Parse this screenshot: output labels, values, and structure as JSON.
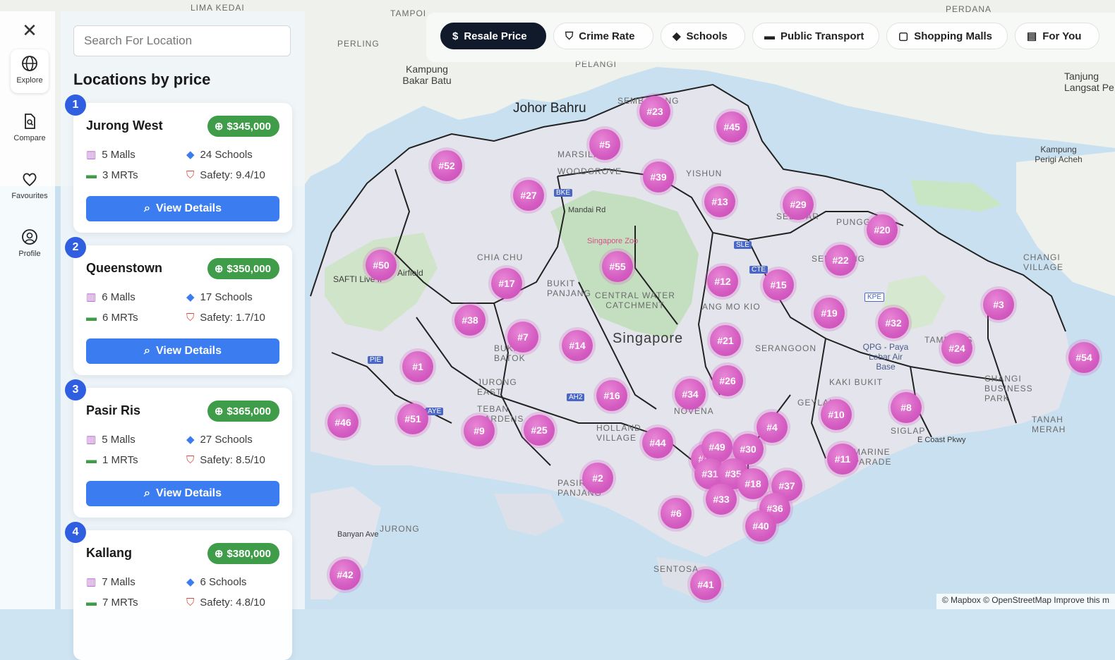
{
  "map": {
    "labels": [
      "LIMA KEDAI",
      "TAMPOI",
      "PERDANA",
      "PERLING",
      "PELANGI",
      "Kampung Bakar Batu",
      "Johor Bahru",
      "Tanjung Langsat Pe",
      "Kampung Perigi Acheh",
      "Singapore Zoo",
      "SAFTI Live IF",
      "Airfield",
      "CENTRAL WATER CATCHMENT",
      "Singapore",
      "CHIA CHU",
      "BUKIT PANJANG",
      "BUKIT BATOK",
      "JURONG EAST",
      "TEBAN GARDENS",
      "HOLLAND VILLAGE",
      "PASIR PANJANG",
      "JURONG",
      "SENTOSA",
      "NOVENA",
      "ANG MO KIO",
      "SERANGOON",
      "QPG - Paya Lebar Air Base",
      "TAMPINES",
      "CHANGI VILLAGE",
      "CHANGI BUSINESS PARK",
      "TANAH MERAH",
      "SIGLAP",
      "MARINE PARADE",
      "KAKI BUKIT",
      "GEYLANG",
      "WOODGROVE",
      "MARSILING",
      "YISHUN",
      "SELETAR",
      "PUNGGOL",
      "SENGKANG",
      "SEMBAWANG",
      "Mandai Rd",
      "E Coast Pkwy",
      "Banyan Ave",
      "AYE",
      "PIE",
      "KPE",
      "CTE",
      "SLE",
      "BKE",
      "AH2"
    ],
    "markers": [
      "#23",
      "#45",
      "#5",
      "#52",
      "#39",
      "#27",
      "#13",
      "#29",
      "#20",
      "#50",
      "#55",
      "#22",
      "#17",
      "#12",
      "#15",
      "#3",
      "#19",
      "#38",
      "#7",
      "#14",
      "#32",
      "#21",
      "#24",
      "#54",
      "#1",
      "#16",
      "#34",
      "#26",
      "#46",
      "#51",
      "#9",
      "#25",
      "#10",
      "#8",
      "#4",
      "#44",
      "#49",
      "#30",
      "#11",
      "#2",
      "#35",
      "#18",
      "#37",
      "#33",
      "#36",
      "#6",
      "#40",
      "#42",
      "#41",
      "#43",
      "#31"
    ],
    "attribution": "© Mapbox © OpenStreetMap Improve this m"
  },
  "rail": {
    "close_icon": "close-icon",
    "items": [
      {
        "label": "Explore",
        "icon": "globe-icon"
      },
      {
        "label": "Compare",
        "icon": "compare-doc-icon"
      },
      {
        "label": "Favourites",
        "icon": "heart-icon"
      },
      {
        "label": "Profile",
        "icon": "user-circle-icon"
      }
    ]
  },
  "panel": {
    "search_placeholder": "Search For Location",
    "title": "Locations by price",
    "view_label": "View Details",
    "cards": [
      {
        "rank": "1",
        "name": "Jurong West",
        "price": "$345,000",
        "malls": "5 Malls",
        "schools": "24 Schools",
        "mrts": "3 MRTs",
        "safety": "Safety: 9.4/10"
      },
      {
        "rank": "2",
        "name": "Queenstown",
        "price": "$350,000",
        "malls": "6 Malls",
        "schools": "17 Schools",
        "mrts": "6 MRTs",
        "safety": "Safety: 1.7/10"
      },
      {
        "rank": "3",
        "name": "Pasir Ris",
        "price": "$365,000",
        "malls": "5 Malls",
        "schools": "27 Schools",
        "mrts": "1 MRTs",
        "safety": "Safety: 8.5/10"
      },
      {
        "rank": "4",
        "name": "Kallang",
        "price": "$380,000",
        "malls": "7 Malls",
        "schools": "6 Schools",
        "mrts": "7 MRTs",
        "safety": "Safety: 4.8/10"
      }
    ]
  },
  "topbar": {
    "chips": [
      {
        "label": "Resale Price",
        "icon": "dollar-circle-icon",
        "active": true
      },
      {
        "label": "Crime Rate",
        "icon": "shield-alert-icon",
        "active": false
      },
      {
        "label": "Schools",
        "icon": "graduation-cap-icon",
        "active": false
      },
      {
        "label": "Public Transport",
        "icon": "bus-icon",
        "active": false
      },
      {
        "label": "Shopping Malls",
        "icon": "shopping-bag-icon",
        "active": false
      },
      {
        "label": "For You",
        "icon": "map-icon",
        "active": false
      }
    ]
  },
  "colors": {
    "accent": "#3b7cf0",
    "price_badge": "#3f9c48",
    "marker": "#d45bc1",
    "active_chip": "#111a2b",
    "rank_badge": "#2f5ee0"
  }
}
